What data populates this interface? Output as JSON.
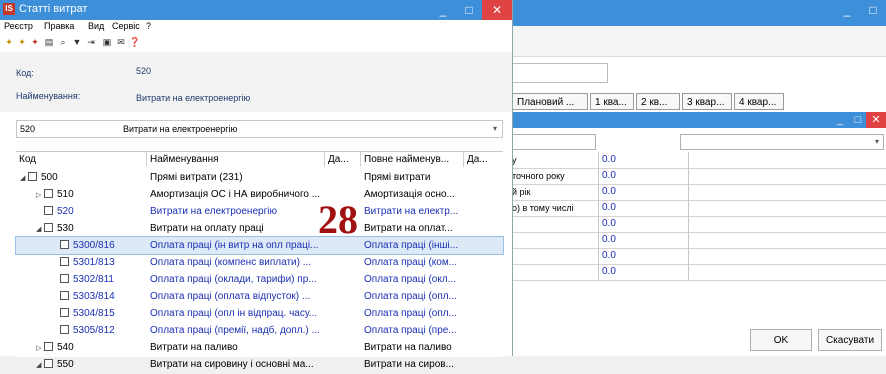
{
  "window": {
    "title": "Статті витрат",
    "icon_letters": "IS",
    "menu": [
      "Реєстр",
      "Правка",
      "Вид",
      "Сервіс",
      "?"
    ]
  },
  "form": {
    "code_label": "Код:",
    "code_value": "520",
    "name_label": "Найменування:",
    "name_value": "Витрати на електроенергію"
  },
  "selector": {
    "code": "520",
    "name": "Витрати на електроенергію"
  },
  "grid": {
    "headers": [
      "Код",
      "Найменування",
      "Да...",
      "Повне найменув...",
      "Да..."
    ],
    "rows": [
      {
        "indent": 0,
        "expander": "▲",
        "code": "500",
        "name": "Прямі витрати (231)",
        "full": "Прямі витрати",
        "blue": false,
        "selected": false
      },
      {
        "indent": 1,
        "expander": "▷",
        "code": "510",
        "name": "Амортизація ОС і НА виробничого ...",
        "full": "Амортизація осно...",
        "blue": false,
        "selected": false
      },
      {
        "indent": 1,
        "expander": "",
        "code": "520",
        "name": "Витрати на електроенергію",
        "full": "Витрати на електр...",
        "blue": true,
        "selected": false
      },
      {
        "indent": 1,
        "expander": "▲",
        "code": "530",
        "name": "Витрати на оплату праці",
        "full": "Витрати на оплат...",
        "blue": false,
        "selected": false
      },
      {
        "indent": 2,
        "expander": "",
        "code": "5300/816",
        "name": "Оплата праці (ін витр на опл праці...",
        "full": "Оплата праці (інші...",
        "blue": true,
        "selected": true
      },
      {
        "indent": 2,
        "expander": "",
        "code": "5301/813",
        "name": "Оплата праці (компенс виплати) ...",
        "full": "Оплата праці (ком...",
        "blue": true,
        "selected": false
      },
      {
        "indent": 2,
        "expander": "",
        "code": "5302/811",
        "name": "Оплата праці (оклади, тарифи) пр...",
        "full": "Оплата праці (окл...",
        "blue": true,
        "selected": false
      },
      {
        "indent": 2,
        "expander": "",
        "code": "5303/814",
        "name": "Оплата праці (оплата відпусток) ...",
        "full": "Оплата праці (опл...",
        "blue": true,
        "selected": false
      },
      {
        "indent": 2,
        "expander": "",
        "code": "5304/815",
        "name": "Оплата праці (опл ін відпрац. часу...",
        "full": "Оплата праці (опл...",
        "blue": true,
        "selected": false
      },
      {
        "indent": 2,
        "expander": "",
        "code": "5305/812",
        "name": "Оплата праці (премії, надб, допл.) ...",
        "full": "Оплата праці (пре...",
        "blue": true,
        "selected": false
      },
      {
        "indent": 1,
        "expander": "▷",
        "code": "540",
        "name": "Витрати на паливо",
        "full": "Витрати на паливо",
        "blue": false,
        "selected": false
      },
      {
        "indent": 1,
        "expander": "▲",
        "code": "550",
        "name": "Витрати на сировину і основні ма...",
        "full": "Витрати на сиров...",
        "blue": false,
        "selected": false
      }
    ]
  },
  "annotation": "28",
  "background": {
    "tabs": [
      "Плановий ...",
      "1 ква...",
      "2 кв...",
      "3 квар...",
      "4 квар..."
    ],
    "grid_rows": [
      {
        "label": "у",
        "value": "0.0"
      },
      {
        "label": "точного року",
        "value": "0.0"
      },
      {
        "label": "й рік",
        "value": "0.0"
      },
      {
        "label": "о) в тому числі",
        "value": "0.0"
      },
      {
        "label": "",
        "value": "0.0"
      },
      {
        "label": "",
        "value": "0.0"
      },
      {
        "label": "",
        "value": "0.0"
      },
      {
        "label": "",
        "value": "0.0"
      }
    ],
    "ok_label": "OK",
    "cancel_label": "Скасувати"
  }
}
